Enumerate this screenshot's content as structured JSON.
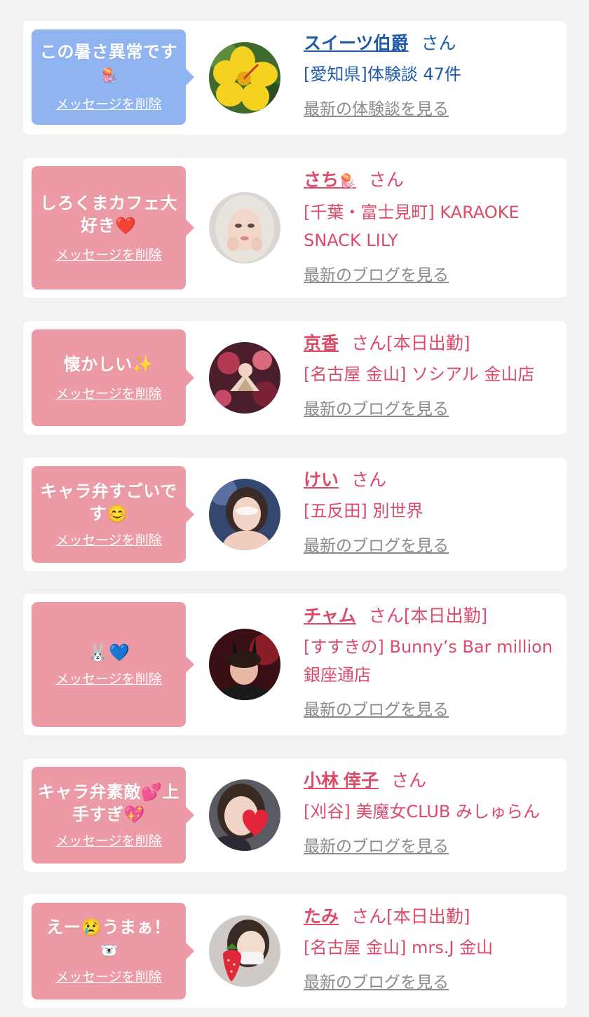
{
  "items": [
    {
      "msg_line1": "この暑さ異常です",
      "msg_emoji": "🪼",
      "msg_line2": "",
      "delete": "メッセージを削除",
      "name": "スイーツ伯爵",
      "name_emoji": "",
      "san": "さん",
      "status": "",
      "shop": "[愛知県]体験談 47件",
      "link": "最新の体験談を見る",
      "avatar": "hibiscus-flower-avatar",
      "theme": "blue"
    },
    {
      "msg_line1": "しろくまカフェ大",
      "msg_emoji": "",
      "msg_line2": "好き❤️",
      "delete": "メッセージを削除",
      "name": "さち",
      "name_emoji": "🪼",
      "san": "さん",
      "status": "",
      "shop": "[千葉・富士見町] KARAOKE SNACK LILY",
      "link": "最新のブログを見る",
      "avatar": "woman-portrait-avatar",
      "theme": "pink"
    },
    {
      "msg_line1": "懐かしい✨",
      "msg_emoji": "",
      "msg_line2": "",
      "delete": "メッセージを削除",
      "name": "京香",
      "name_emoji": "",
      "san": "さん",
      "status": "[本日出勤]",
      "shop": "[名古屋 金山] ソシアル 金山店",
      "link": "最新のブログを見る",
      "avatar": "kimono-fan-avatar",
      "theme": "pink"
    },
    {
      "msg_line1": "キャラ弁すごいで",
      "msg_emoji": "",
      "msg_line2": "す😊",
      "delete": "メッセージを削除",
      "name": "けい",
      "name_emoji": "",
      "san": "さん",
      "status": "",
      "shop": "[五反田] 別世界",
      "link": "最新のブログを見る",
      "avatar": "woman-selfie-avatar",
      "theme": "pink"
    },
    {
      "msg_line1": "🐰💙",
      "msg_emoji": "",
      "msg_line2": "",
      "delete": "メッセージを削除",
      "name": "チャム",
      "name_emoji": "",
      "san": "さん",
      "status": "[本日出勤]",
      "shop": "[すすきの] Bunny’s Bar million 銀座通店",
      "link": "最新のブログを見る",
      "avatar": "bunny-ears-avatar",
      "theme": "pink"
    },
    {
      "msg_line1": "キャラ弁素敵💕上",
      "msg_emoji": "",
      "msg_line2": "手すぎ💖",
      "delete": "メッセージを削除",
      "name": "小林 倖子",
      "name_emoji": "",
      "san": "さん",
      "status": "",
      "shop": "[刈谷] 美魔女CLUB みしゅらん",
      "link": "最新のブログを見る",
      "avatar": "heart-face-avatar",
      "theme": "pink"
    },
    {
      "msg_line1": "えー😢うまぁ！",
      "msg_emoji": "🐻‍❄️",
      "msg_line2": "",
      "delete": "メッセージを削除",
      "name": "たみ",
      "name_emoji": "",
      "san": "さん",
      "status": "[本日出勤]",
      "shop": "[名古屋 金山] mrs.J 金山",
      "link": "最新のブログを見る",
      "avatar": "strawberry-mask-avatar",
      "theme": "pink"
    }
  ]
}
